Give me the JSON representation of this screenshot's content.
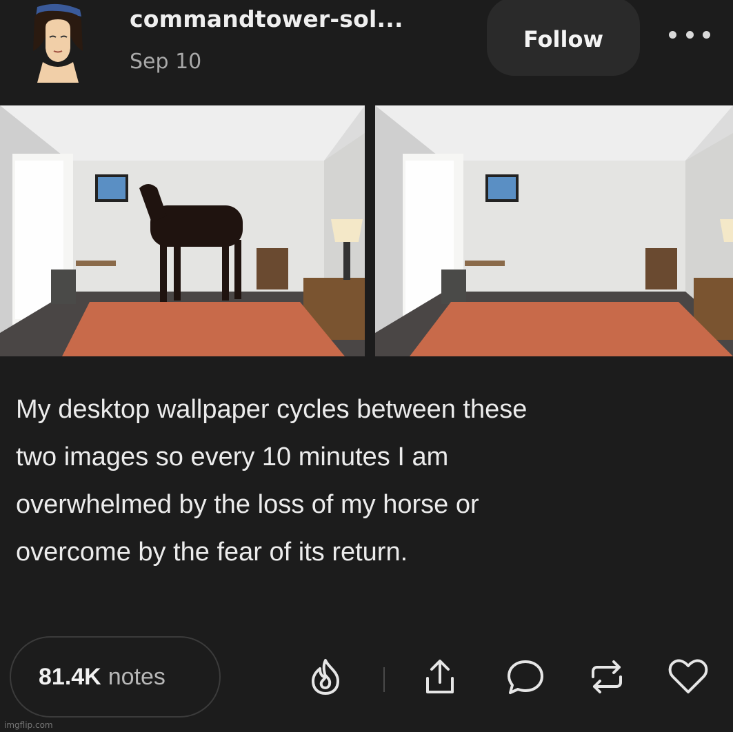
{
  "post": {
    "username": "commandtower-sol...",
    "date": "Sep 10",
    "follow_label": "Follow",
    "caption_lines": [
      "My desktop wallpaper cycles between these",
      "two images so every 10 minutes I am",
      "overwhelmed by the loss of my horse or",
      "overcome by the fear of its return."
    ]
  },
  "footer": {
    "notes_count": "81.4K",
    "notes_label": "notes",
    "actions": [
      "flame-icon",
      "share-icon",
      "reply-icon",
      "reblog-icon",
      "like-icon"
    ]
  },
  "watermark": "imgflip.com",
  "colors": {
    "background": "#1c1c1c",
    "follow_bg": "#2a2a2a",
    "text": "#e6e6e6",
    "muted": "#a9a9a9",
    "bed": "#c86a4a"
  }
}
